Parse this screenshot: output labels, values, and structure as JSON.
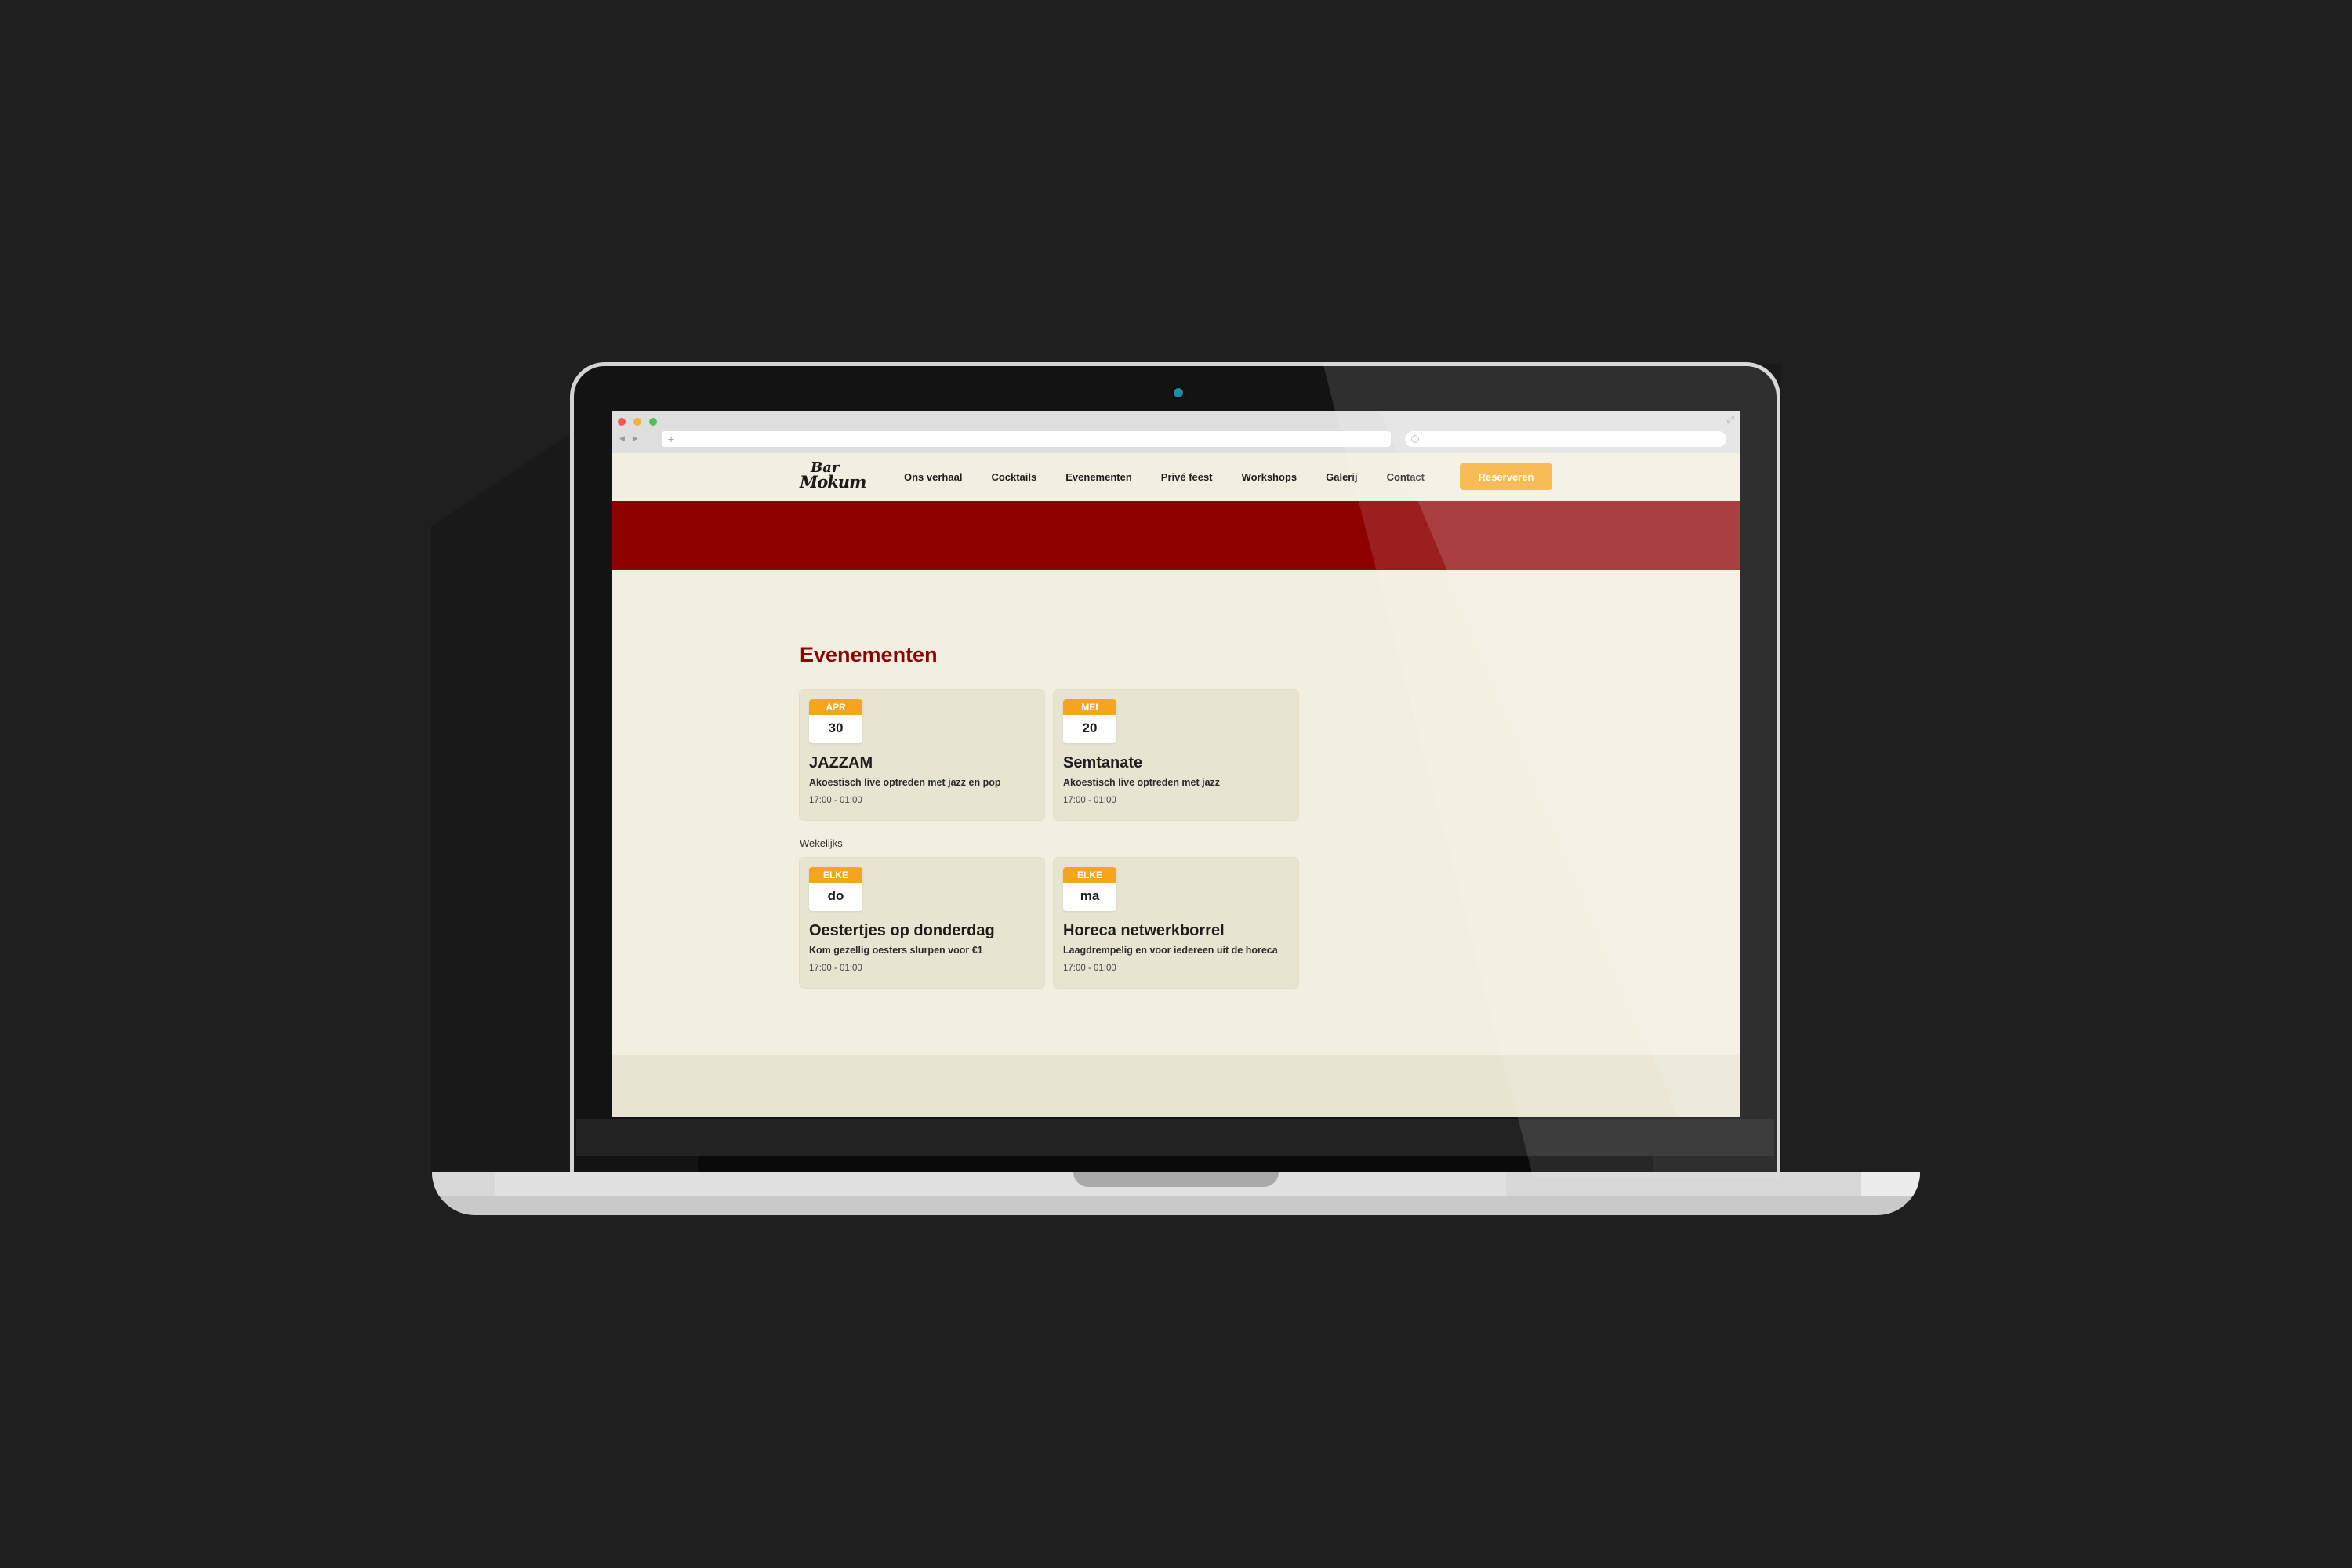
{
  "site": {
    "logo_text": [
      "Bar",
      "Mokum"
    ],
    "nav": [
      "Ons verhaal",
      "Cocktails",
      "Evenementen",
      "Privé feest",
      "Workshops",
      "Galerij",
      "Contact"
    ],
    "cta": "Reserveren"
  },
  "browser": {
    "back": "◀",
    "forward": "▶",
    "new_tab": "+",
    "expand": "⤢"
  },
  "page": {
    "title": "Evenementen",
    "weekly_label": "Wekelijks"
  },
  "events": [
    {
      "month": "APR",
      "day": "30",
      "title": "JAZZAM",
      "desc": "Akoestisch live optreden met jazz en pop",
      "time": "17:00 - 01:00"
    },
    {
      "month": "MEI",
      "day": "20",
      "title": "Semtanate",
      "desc": "Akoestisch live optreden met jazz",
      "time": "17:00 - 01:00"
    }
  ],
  "weekly": [
    {
      "month": "ELKE",
      "day": "do",
      "title": "Oestertjes op donderdag",
      "desc": "Kom gezellig oesters slurpen voor €1",
      "time": "17:00 - 01:00"
    },
    {
      "month": "ELKE",
      "day": "ma",
      "title": "Horeca netwerkborrel",
      "desc": "Laagdrempelig en voor iedereen uit de horeca",
      "time": "17:00 - 01:00"
    }
  ],
  "colors": {
    "accent_red": "#8e0000",
    "accent_orange": "#f6a61e",
    "page_bg": "#f1efe0",
    "card_bg": "#e7e4d1",
    "backdrop": "#1f1f1f"
  }
}
